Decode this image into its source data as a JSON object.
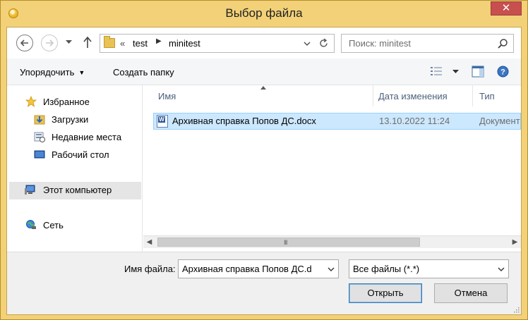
{
  "window": {
    "title": "Выбор файла",
    "close_symbol": "✕",
    "accent_color": "#f2d178",
    "close_color": "#c7504f"
  },
  "nav": {
    "back_icon": "back-arrow-icon",
    "forward_icon": "forward-arrow-icon",
    "up_icon": "up-arrow-icon",
    "breadcrumb": {
      "overflow": "«",
      "segments": [
        "test",
        "minitest"
      ]
    },
    "search_placeholder": "Поиск: minitest"
  },
  "toolbar": {
    "organize_label": "Упорядочить",
    "new_folder_label": "Создать папку"
  },
  "sidebar": {
    "items": [
      {
        "label": "Избранное",
        "icon": "star-icon"
      },
      {
        "label": "Загрузки",
        "icon": "downloads-icon"
      },
      {
        "label": "Недавние места",
        "icon": "recent-places-icon"
      },
      {
        "label": "Рабочий стол",
        "icon": "desktop-icon"
      },
      {
        "label": "Этот компьютер",
        "icon": "computer-icon"
      },
      {
        "label": "Сеть",
        "icon": "network-icon"
      }
    ]
  },
  "filelist": {
    "columns": [
      "Имя",
      "Дата изменения",
      "Тип"
    ],
    "rows": [
      {
        "name": "Архивная справка Попов ДС.docx",
        "date": "13.10.2022 11:24",
        "type": "Документ",
        "icon": "word-document-icon",
        "selected": true
      }
    ],
    "scroll_grip": "III"
  },
  "bottom": {
    "filename_label": "Имя файла:",
    "filename_value": "Архивная справка Попов ДС.d",
    "filter_value": "Все файлы (*.*)",
    "open_label": "Открыть",
    "cancel_label": "Отмена"
  }
}
